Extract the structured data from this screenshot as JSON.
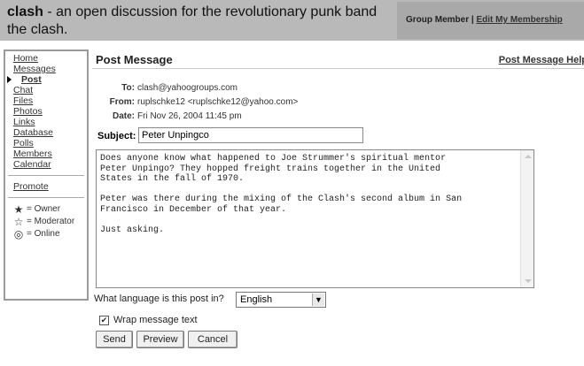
{
  "header": {
    "group_name": "clash",
    "title_rest": " - an open discussion for the revolutionary punk band the clash.",
    "member_status": "Group Member",
    "separator": " | ",
    "edit_membership": "Edit My Membership"
  },
  "sidebar": {
    "items": [
      {
        "label": "Home"
      },
      {
        "label": "Messages"
      },
      {
        "label": "Post"
      },
      {
        "label": "Chat"
      },
      {
        "label": "Files"
      },
      {
        "label": "Photos"
      },
      {
        "label": "Links"
      },
      {
        "label": "Database"
      },
      {
        "label": "Polls"
      },
      {
        "label": "Members"
      },
      {
        "label": "Calendar"
      }
    ],
    "promote": "Promote",
    "legend": [
      {
        "icon": "star-filled-icon",
        "glyph": "★",
        "label": "= Owner"
      },
      {
        "icon": "star-outline-icon",
        "glyph": "☆",
        "label": "= Moderator"
      },
      {
        "icon": "online-icon",
        "glyph": "◎",
        "label": "= Online"
      }
    ]
  },
  "main": {
    "title": "Post Message",
    "help_link": "Post Message Help",
    "to_label": "To:",
    "to_value": "clash@yahoogroups.com",
    "from_label": "From:",
    "from_value": "ruplschke12 <ruplschke12@yahoo.com>",
    "date_label": "Date:",
    "date_value": "Fri Nov 26, 2004 11:45 pm",
    "subject_label": "Subject:",
    "subject_value": "Peter Unpingco",
    "message_body": "Does anyone know what happened to Joe Strummer's spiritual mentor\nPeter Unpingo? They hopped freight trains together in the United\nStates in the fall of 1970.\n\nPeter was there during the mixing of the Clash's second album in San\nFrancisco in December of that year.\n\nJust asking.",
    "language_prompt": "What language is this post in?",
    "language_value": "English",
    "wrap_label": "Wrap message text",
    "wrap_checked": true,
    "buttons": {
      "send": "Send",
      "preview": "Preview",
      "cancel": "Cancel"
    }
  }
}
